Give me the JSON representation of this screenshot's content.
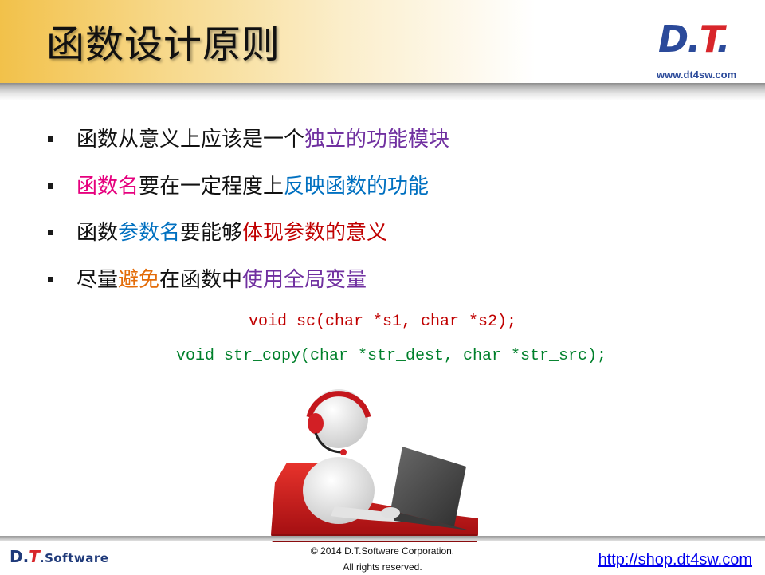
{
  "title": "函数设计原则",
  "logo": {
    "d": "D",
    "dot1": ".",
    "t": "T",
    "dot2": "."
  },
  "url_top": "www.dt4sw.com",
  "bullets": [
    {
      "parts": [
        {
          "text": "函数从意义上应该是一个",
          "color": "default"
        },
        {
          "text": "独立的功能模块",
          "color": "purple"
        }
      ]
    },
    {
      "parts": [
        {
          "text": "函数名",
          "color": "magenta"
        },
        {
          "text": "要在一定程度上",
          "color": "default"
        },
        {
          "text": "反映函数的功能",
          "color": "blue"
        }
      ]
    },
    {
      "parts": [
        {
          "text": "函数",
          "color": "default"
        },
        {
          "text": "参数名",
          "color": "blue"
        },
        {
          "text": "要能够",
          "color": "default"
        },
        {
          "text": "体现参数的意义",
          "color": "red"
        }
      ]
    },
    {
      "parts": [
        {
          "text": "尽量",
          "color": "default"
        },
        {
          "text": "避免",
          "color": "orange"
        },
        {
          "text": "在函数中",
          "color": "default"
        },
        {
          "text": "使用全局变量",
          "color": "purple"
        }
      ]
    }
  ],
  "code": {
    "line1": "void sc(char *s1, char *s2);",
    "line2": "void str_copy(char *str_dest, char *str_src);"
  },
  "footer": {
    "logo_d": "D",
    "logo_t": "T",
    "logo_rest": ".Software",
    "copyright_line1": "© 2014 D.T.Software Corporation.",
    "copyright_line2": "All rights reserved.",
    "url": "http://shop.dt4sw.com"
  },
  "colors": {
    "purple": "#7030a0",
    "magenta": "#e6007e",
    "blue": "#0070c0",
    "red": "#c00000",
    "orange": "#e36c09",
    "code_red": "#c00000",
    "code_green": "#00802b"
  }
}
